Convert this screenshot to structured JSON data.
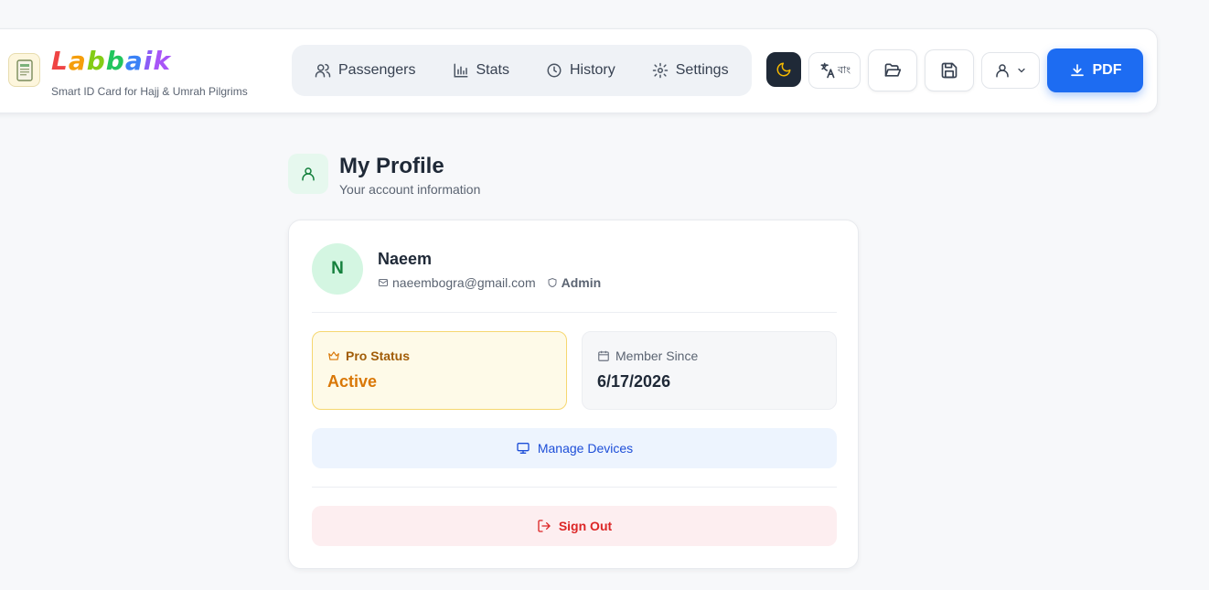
{
  "header": {
    "brand_letters": [
      "L",
      "a",
      "b",
      "b",
      "a",
      "i",
      "k"
    ],
    "tagline": "Smart ID Card for Hajj & Umrah Pilgrims",
    "nav": [
      {
        "label": "Passengers",
        "icon": "users-icon"
      },
      {
        "label": "Stats",
        "icon": "bar-chart-icon"
      },
      {
        "label": "History",
        "icon": "clock-icon"
      },
      {
        "label": "Settings",
        "icon": "gear-icon"
      }
    ],
    "language_toggle_label": "বাং",
    "pdf_label": "PDF"
  },
  "page": {
    "title": "My Profile",
    "subtitle": "Your account information"
  },
  "profile": {
    "avatar_initial": "N",
    "name": "Naeem",
    "email": "naeembogra@gmail.com",
    "role": "Admin",
    "pro_status_label": "Pro Status",
    "pro_status_value": "Active",
    "member_since_label": "Member Since",
    "member_since_value": "6/17/2026",
    "manage_devices_label": "Manage Devices",
    "sign_out_label": "Sign Out"
  },
  "colors": {
    "primary": "#1d6cf2",
    "success": "#15803d",
    "warning": "#d97706",
    "danger": "#dc2626"
  }
}
